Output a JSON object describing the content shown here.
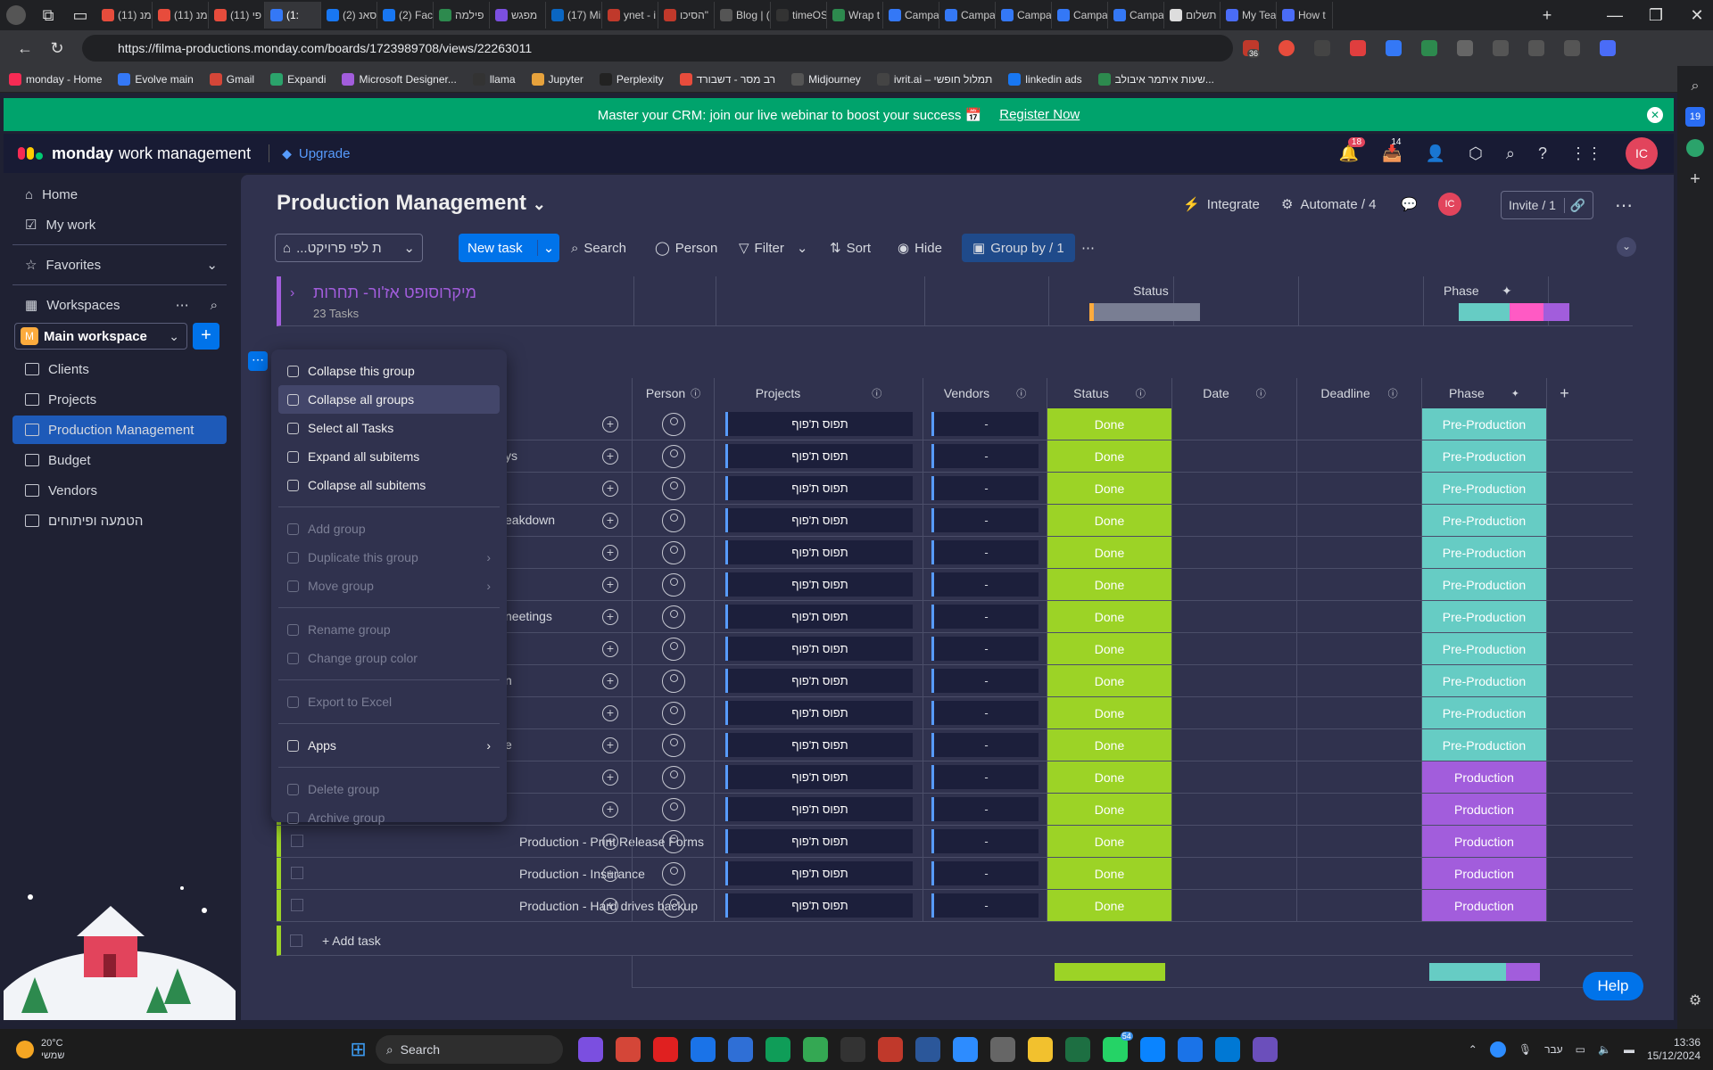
{
  "browser": {
    "tabs": [
      "(11) מנ",
      "(11) מנ",
      "(11) פי",
      "(1:",
      "(2) סאנ",
      "(2) Face",
      "פילמה",
      "מפגש",
      "(17) Mi",
      "ynet - i",
      "הסיכו\"",
      "Blog | (",
      "timeOS",
      "Wrap t",
      "Campa",
      "Campa",
      "Campa",
      "Campa",
      "Campa",
      "תשלום",
      "My Tea",
      "How t"
    ],
    "url": "https://filma-productions.monday.com/boards/1723989708/views/22263011",
    "ext_badge": "36",
    "bookmarks": [
      "monday - Home",
      "Evolve main",
      "Gmail",
      "Expandi",
      "Microsoft Designer...",
      "llama",
      "Jupyter",
      "Perplexity",
      "רב מסר - דשבורד",
      "Midjourney",
      "ivrit.ai – תמלול חופשי",
      "linkedin ads",
      "שעות איתמר איבולב..."
    ],
    "rail_badge": "19"
  },
  "banner": {
    "text": "Master your CRM: join our live webinar to boost your success 📅",
    "link": "Register Now"
  },
  "app": {
    "brand_bold": "monday",
    "brand_rest": "work management",
    "upgrade": "Upgrade",
    "notif_count": "18",
    "inbox_count": "14",
    "avatar": "IC"
  },
  "sidebar": {
    "home": "Home",
    "mywork": "My work",
    "favorites": "Favorites",
    "workspaces": "Workspaces",
    "workspace_name": "Main workspace",
    "workspace_letter": "M",
    "items": [
      "Clients",
      "Projects",
      "Production Management",
      "Budget",
      "Vendors",
      "הטמעה ופיתוחים"
    ]
  },
  "board": {
    "title": "Production Management",
    "integrate": "Integrate",
    "automate": "Automate / 4",
    "invite": "Invite / 1",
    "view_selector": "...ת לפי פרויקט",
    "new_task": "New task",
    "search": "Search",
    "person": "Person",
    "filter": "Filter",
    "sort": "Sort",
    "hide": "Hide",
    "groupby": "Group by / 1",
    "group_title": "מיקרוסופט אז'ור- תחרות",
    "group_count": "23 Tasks",
    "collapsed_headers": {
      "status": "Status",
      "phase": "Phase"
    },
    "columns": {
      "person": "Person",
      "projects": "Projects",
      "vendors": "Vendors",
      "status": "Status",
      "date": "Date",
      "deadline": "Deadline",
      "phase": "Phase"
    },
    "rows": [
      {
        "name": "",
        "suffix": "",
        "project": "תפוס ת'פוף",
        "vendor": "-",
        "status": "Done",
        "phase": "Pre-Production"
      },
      {
        "name": "",
        "suffix": "ys",
        "project": "תפוס ת'פוף",
        "vendor": "-",
        "status": "Done",
        "phase": "Pre-Production"
      },
      {
        "name": "",
        "suffix": "",
        "project": "תפוס ת'פוף",
        "vendor": "-",
        "status": "Done",
        "phase": "Pre-Production"
      },
      {
        "name": "",
        "suffix": "eakdown",
        "project": "תפוס ת'פוף",
        "vendor": "-",
        "status": "Done",
        "phase": "Pre-Production"
      },
      {
        "name": "",
        "suffix": "",
        "project": "תפוס ת'פוף",
        "vendor": "-",
        "status": "Done",
        "phase": "Pre-Production"
      },
      {
        "name": "",
        "suffix": "",
        "project": "תפוס ת'פוף",
        "vendor": "-",
        "status": "Done",
        "phase": "Pre-Production"
      },
      {
        "name": "",
        "suffix": "neetings",
        "project": "תפוס ת'פוף",
        "vendor": "-",
        "status": "Done",
        "phase": "Pre-Production"
      },
      {
        "name": "",
        "suffix": "",
        "project": "תפוס ת'פוף",
        "vendor": "-",
        "status": "Done",
        "phase": "Pre-Production"
      },
      {
        "name": "",
        "suffix": "n",
        "project": "תפוס ת'פוף",
        "vendor": "-",
        "status": "Done",
        "phase": "Pre-Production"
      },
      {
        "name": "",
        "suffix": "",
        "project": "תפוס ת'פוף",
        "vendor": "-",
        "status": "Done",
        "phase": "Pre-Production"
      },
      {
        "name": "",
        "suffix": "e",
        "project": "תפוס ת'פוף",
        "vendor": "-",
        "status": "Done",
        "phase": "Pre-Production"
      },
      {
        "name": "",
        "suffix": "",
        "project": "תפוס ת'פוף",
        "vendor": "-",
        "status": "Done",
        "phase": "Production"
      },
      {
        "name": "",
        "suffix": "",
        "project": "תפוס ת'פוף",
        "vendor": "-",
        "status": "Done",
        "phase": "Production"
      },
      {
        "name": "Production - Print Release Forms",
        "suffix": "",
        "project": "תפוס ת'פוף",
        "vendor": "-",
        "status": "Done",
        "phase": "Production"
      },
      {
        "name": "Production - Insurance",
        "suffix": "",
        "project": "תפוס ת'פוף",
        "vendor": "-",
        "status": "Done",
        "phase": "Production"
      },
      {
        "name": "Production - Hard drives backup",
        "suffix": "",
        "project": "תפוס ת'פוף",
        "vendor": "-",
        "status": "Done",
        "phase": "Production"
      }
    ],
    "add_task": "+ Add task",
    "help": "Help"
  },
  "menu": {
    "items": [
      "Collapse this group",
      "Collapse all groups",
      "Select all Tasks",
      "Expand all subitems",
      "Collapse all subitems"
    ],
    "group_items": [
      "Add group",
      "Duplicate this group",
      "Move group"
    ],
    "rename_items": [
      "Rename group",
      "Change group color"
    ],
    "export": "Export to Excel",
    "apps": "Apps",
    "delete_items": [
      "Delete group",
      "Archive group"
    ]
  },
  "taskbar": {
    "weather_temp": "20°C",
    "weather_desc": "שמשי",
    "search": "Search",
    "lang": "עבר",
    "time": "13:36",
    "date": "15/12/2024",
    "whatsapp_badge": "54"
  },
  "colors": {
    "done": "#9cd326",
    "pre_production": "#66ccc4",
    "production": "#a25ddc",
    "banner": "#00a36c",
    "accent": "#0073ea"
  }
}
